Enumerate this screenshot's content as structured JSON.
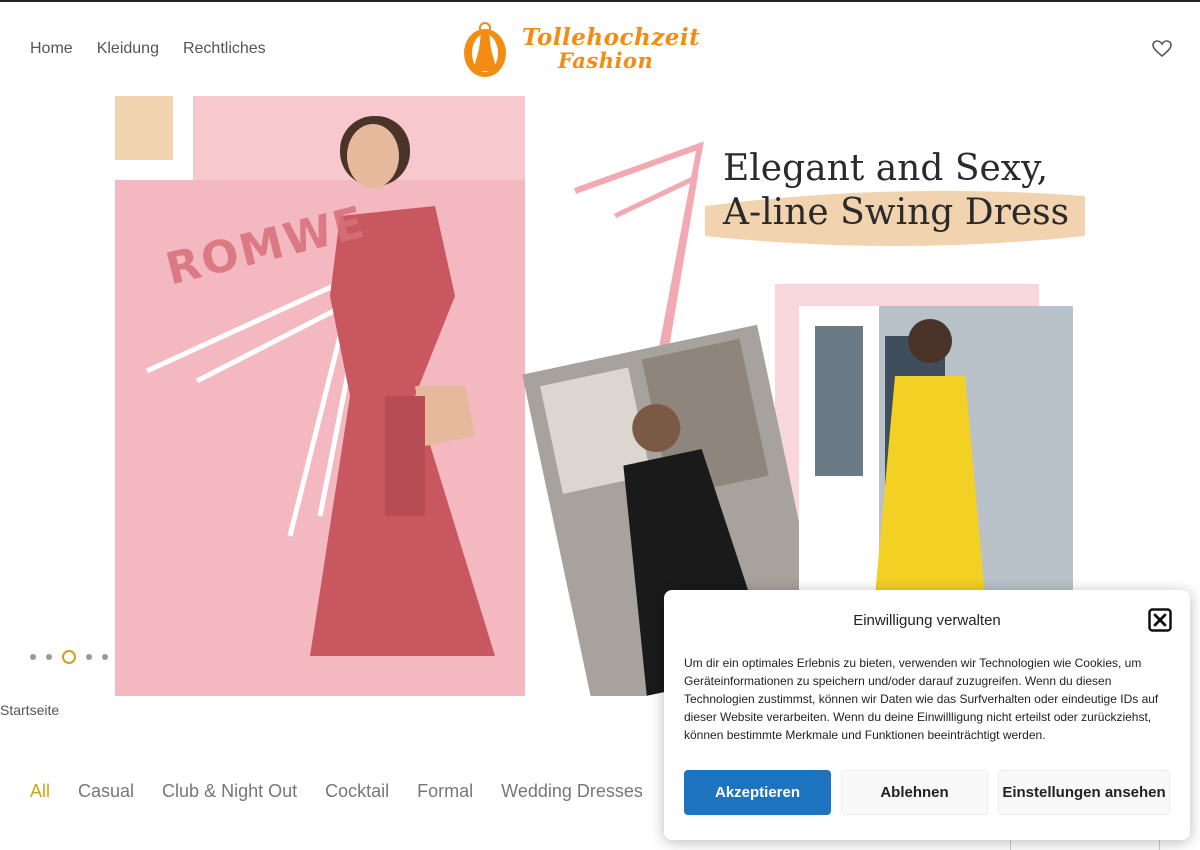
{
  "header": {
    "nav": [
      "Home",
      "Kleidung",
      "Rechtliches"
    ],
    "logo_line1": "Tollehochzeit",
    "logo_line2": "Fashion",
    "wishlist_icon": "heart-icon"
  },
  "hero": {
    "headline_line1": "Elegant and Sexy,",
    "headline_line2": "A-line Swing Dress",
    "brand_watermark": "ROMWE",
    "slider_dots": 5,
    "active_slide": 3
  },
  "breadcrumb": "Startseite",
  "categories": {
    "items": [
      "All",
      "Casual",
      "Club & Night Out",
      "Cocktail",
      "Formal",
      "Wedding Dresses"
    ],
    "active": "All"
  },
  "consent": {
    "title": "Einwilligung verwalten",
    "body": "Um dir ein optimales Erlebnis zu bieten, verwenden wir Technologien wie Cookies, um Geräteinformationen zu speichern und/oder darauf zuzugreifen. Wenn du diesen Technologien zustimmst, können wir Daten wie das Surfverhalten oder eindeutige IDs auf dieser Website verarbeiten. Wenn du deine Einwillligung nicht erteilst oder zurückziehst, können bestimmte Merkmale und Funktionen beeinträchtigt werden.",
    "accept_label": "Akzeptieren",
    "deny_label": "Ablehnen",
    "settings_label": "Einstellungen ansehen",
    "close_icon": "close-icon"
  },
  "colors": {
    "brand_orange": "#f28c12",
    "accent_gold": "#d4a017",
    "button_blue": "#1e73be",
    "hero_pink": "#f4b8c0"
  }
}
